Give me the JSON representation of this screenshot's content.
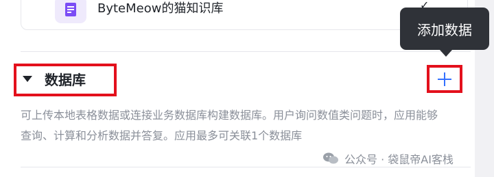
{
  "knowledge_item": {
    "name": "ByteMeow的猫知识库",
    "icon": "document-icon"
  },
  "tooltip": {
    "text": "添加数据"
  },
  "database_section": {
    "title": "数据库",
    "description": "可上传本地表格数据或连接业务数据库构建数据库。用户询问数值类问题时，应用能够查询、计算和分析数据并答复。应用最多可关联1个数据库",
    "add_icon": "plus-icon"
  },
  "watermark": {
    "text": "公众号 · 袋鼠帝AI客栈",
    "icon": "wechat-icon"
  },
  "colors": {
    "highlight_border": "#e3101c",
    "accent_blue": "#3370ff",
    "icon_purple": "#7b4cf5",
    "tooltip_bg": "#2f3238",
    "description_text": "#8a8f99"
  }
}
